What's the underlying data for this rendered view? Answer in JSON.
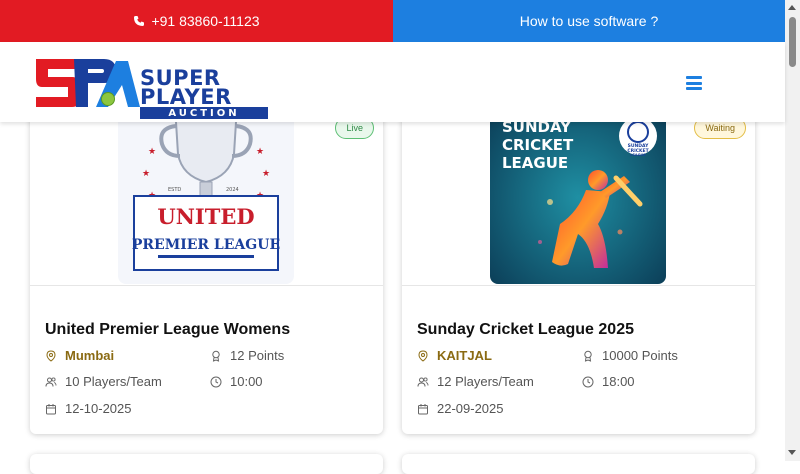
{
  "topbar": {
    "phone": "+91 83860-11123",
    "howto": "How to use software ?"
  },
  "logo": {
    "line1": "SUPER",
    "line2": "PLAYER",
    "line3": "AUCTION"
  },
  "cards": [
    {
      "title": "United Premier League Womens",
      "status": "Live",
      "city": "Mumbai",
      "points": "12 Points",
      "players": "10 Players/Team",
      "time": "10:00",
      "date": "12-10-2025",
      "poster_text1": "UNITED",
      "poster_text2": "PREMIER LEAGUE",
      "poster_estd": "ESTD",
      "poster_year": "2024"
    },
    {
      "title": "Sunday Cricket League 2025",
      "status": "Waiting",
      "city": "KAITJAL",
      "points": "10000 Points",
      "players": "12 Players/Team",
      "time": "18:00",
      "date": "22-09-2025",
      "poster_line1": "SUNDAY",
      "poster_line2": "CRICKET",
      "poster_line3": "LEAGUE",
      "poster_logo1": "SUNDAY",
      "poster_logo2": "CRICKET",
      "poster_logo3": "LEAGUE"
    }
  ],
  "colors": {
    "topbar_red": "#e21b23",
    "topbar_blue": "#1d7fe0",
    "brand_navy": "#1a3f9c",
    "city_gold": "#8a6a12"
  }
}
